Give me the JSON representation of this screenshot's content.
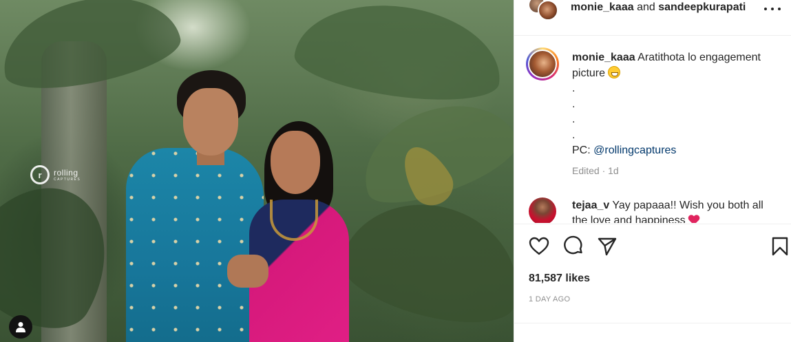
{
  "photo": {
    "watermark_brand": "rolling",
    "watermark_sub": "CAPTURES",
    "tag_icon": "user-icon"
  },
  "header": {
    "user1": "monie_kaaa",
    "connector": "and",
    "user2": "sandeepkurapati",
    "more_icon": "more-horizontal-icon"
  },
  "caption": {
    "username": "monie_kaaa",
    "text": "Aratithota lo engagement picture",
    "emoji": "grinning-face",
    "dots": [
      ".",
      ".",
      ".",
      "."
    ],
    "pc_prefix": "PC:",
    "pc_handle": "@rollingcaptures",
    "meta": "Edited · 1d"
  },
  "comment": {
    "username": "tejaa_v",
    "text": "Yay papaaa!! Wish you both all the love and happiness",
    "emoji": "red-heart"
  },
  "actions": {
    "like_icon": "heart-icon",
    "comment_icon": "comment-icon",
    "share_icon": "share-icon",
    "save_icon": "bookmark-icon"
  },
  "likes": "81,587 likes",
  "timestamp": "1 DAY AGO",
  "colors": {
    "text": "#262626",
    "secondary": "#8e8e8e",
    "link": "#00376b",
    "divider": "#efefef"
  }
}
